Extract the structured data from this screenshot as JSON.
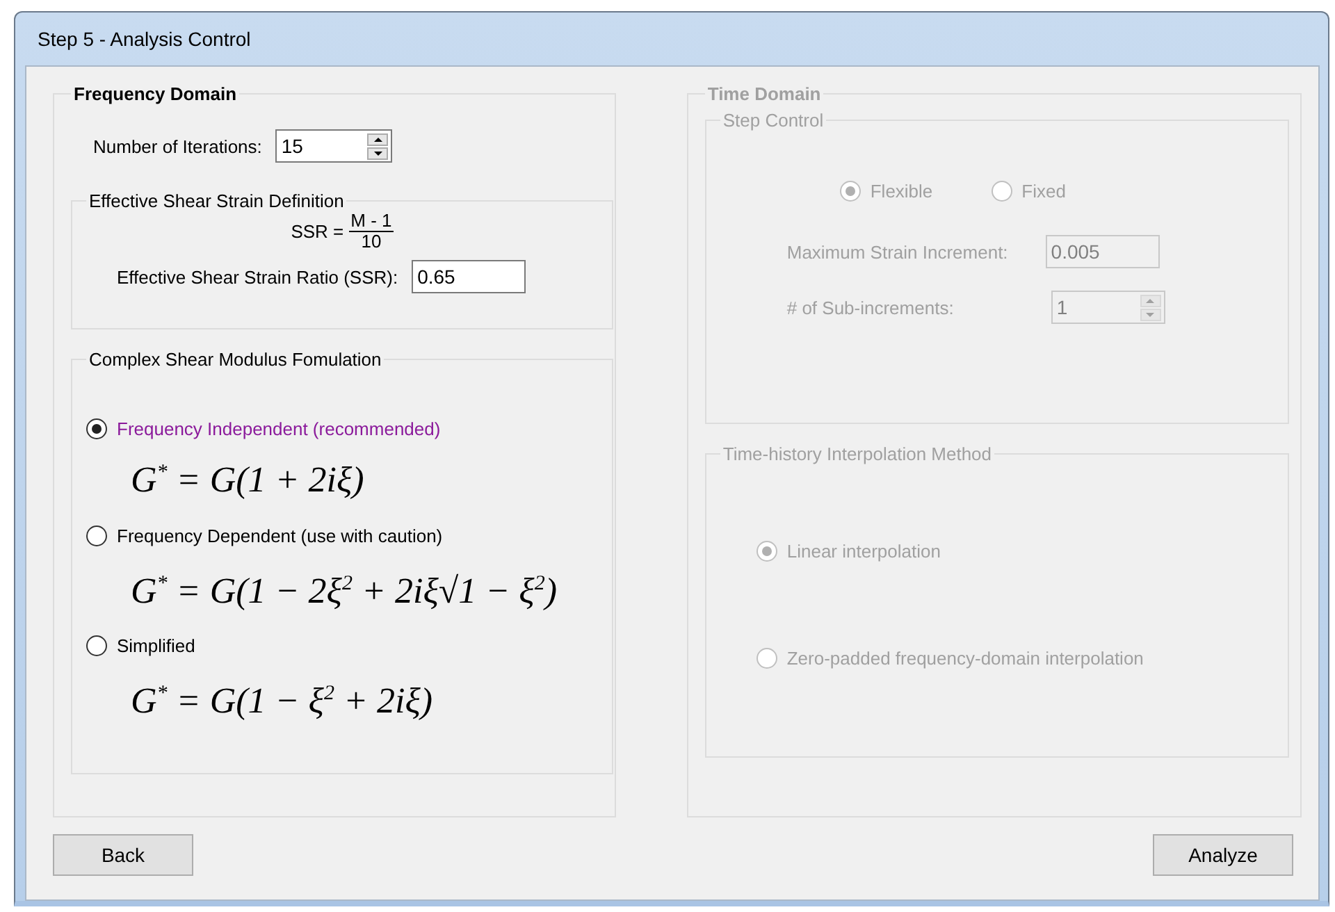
{
  "window": {
    "title": "Step 5 - Analysis Control"
  },
  "frequency_domain": {
    "title": "Frequency Domain",
    "iterations": {
      "label": "Number of Iterations:",
      "value": "15"
    },
    "shear_strain": {
      "title": "Effective Shear Strain Definition",
      "formula": {
        "lhs": "SSR =",
        "numerator": "M - 1",
        "denominator": "10"
      },
      "ratio": {
        "label": "Effective Shear Strain Ratio (SSR):",
        "value": "0.65"
      }
    },
    "modulus": {
      "title": "Complex Shear Modulus Fomulation",
      "options": [
        {
          "label": "Frequency Independent (recommended)",
          "selected": true,
          "formula": "G$^{*}$ = G(1 + 2iξ)"
        },
        {
          "label": "Frequency Dependent (use with caution)",
          "selected": false,
          "formula": "G$^{*}$ = G(1 − 2ξ$^{2}$ + 2iξ√1 − ξ$^{2}$)"
        },
        {
          "label": "Simplified",
          "selected": false,
          "formula": "G$^{*}$ = G(1 − ξ$^{2}$ + 2iξ)"
        }
      ]
    }
  },
  "time_domain": {
    "title": "Time Domain",
    "disabled": true,
    "step_control": {
      "title": "Step Control",
      "options": [
        {
          "label": "Flexible",
          "selected": true
        },
        {
          "label": "Fixed",
          "selected": false
        }
      ],
      "max_strain": {
        "label": "Maximum Strain Increment:",
        "value": "0.005"
      },
      "sub_increments": {
        "label": "# of Sub-increments:",
        "value": "1"
      }
    },
    "interpolation": {
      "title": "Time-history Interpolation Method",
      "options": [
        {
          "label": "Linear interpolation",
          "selected": true
        },
        {
          "label": "Zero-padded frequency-domain interpolation",
          "selected": false
        }
      ]
    }
  },
  "buttons": {
    "back": "Back",
    "analyze": "Analyze"
  }
}
